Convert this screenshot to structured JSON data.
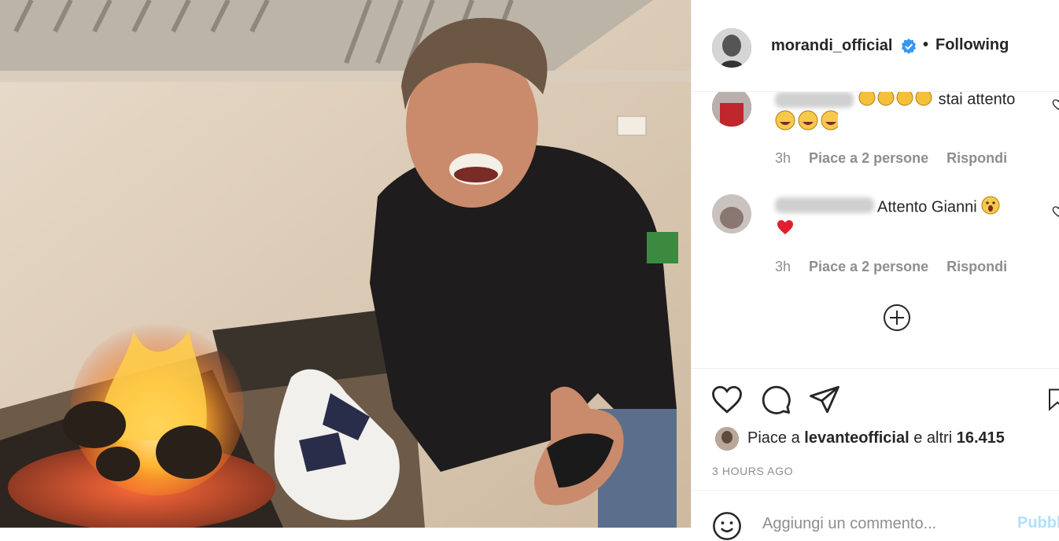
{
  "post": {
    "image_alt": "Man in black sweater laughing next to a grill with fire and oven mitts",
    "author": {
      "username": "morandi_official",
      "verified": true,
      "separator": "•",
      "follow_status": "Following"
    },
    "comments": [
      {
        "text": "stai attento",
        "emoji_prefix": [
          "clap",
          "clap",
          "clap",
          "clap"
        ],
        "emoji_suffix": [
          "joy",
          "joy",
          "joy"
        ],
        "time": "3h",
        "likes": "Piace a 2 persone",
        "reply": "Rispondi"
      },
      {
        "text": "Attento Gianni",
        "emoji_suffix": [
          "astonished",
          "heart"
        ],
        "time": "3h",
        "likes": "Piace a 2 persone",
        "reply": "Rispondi"
      }
    ],
    "load_more_icon": "plus-circle-icon",
    "actions": {
      "like_icon": "heart-icon",
      "comment_icon": "comment-icon",
      "share_icon": "send-icon",
      "save_icon": "bookmark-icon"
    },
    "likes": {
      "prefix": "Piace a",
      "user": "levanteofficial",
      "middle": "e altri",
      "count": "16.415"
    },
    "timestamp": "3 HOURS AGO",
    "add_comment": {
      "placeholder": "Aggiungi un commento...",
      "post_label": "Pubblica"
    }
  },
  "colors": {
    "verified_blue": "#3897f0",
    "meta_gray": "#8e8e8e",
    "post_disabled": "#b2dffc"
  }
}
